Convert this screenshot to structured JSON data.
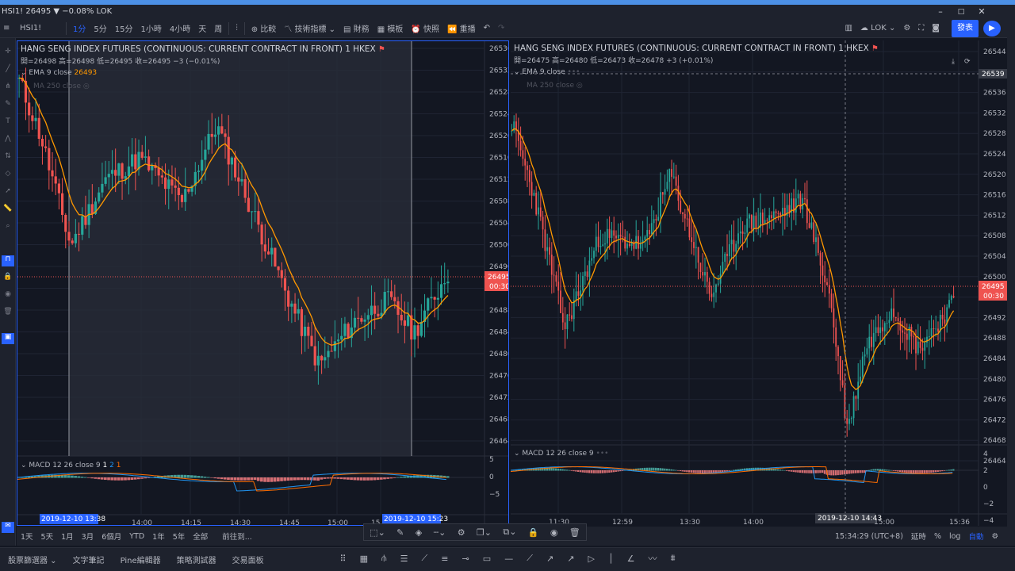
{
  "app": {
    "title": "HSI1! 26495 ▼ −0.08% LOK",
    "window_controls": [
      "–",
      "□",
      "✕",
      "–",
      "⧉"
    ]
  },
  "toolbar": {
    "symbol": "HSI1!",
    "intervals": [
      "1分",
      "5分",
      "15分",
      "1小時",
      "4小時",
      "天",
      "周"
    ],
    "active_interval": "1分",
    "buttons": [
      "比較",
      "技術指標",
      "財務",
      "模板",
      "快照",
      "重播"
    ],
    "layout_label": "LOK",
    "publish_label": "發表"
  },
  "bottom": {
    "ranges": [
      "1天",
      "5天",
      "1月",
      "3月",
      "6個月",
      "YTD",
      "1年",
      "5年",
      "全部"
    ],
    "goto": "前往到...",
    "clock": "15:34:29 (UTC+8)",
    "right": [
      "延時",
      "%",
      "log",
      "自動"
    ],
    "tabs": [
      "股票篩選器",
      "文字筆記",
      "Pine編輯器",
      "策略測試器",
      "交易面板"
    ]
  },
  "colors": {
    "up": "#26a69a",
    "down": "#ef5350",
    "ema": "#ff9800",
    "macd": "#2196f3",
    "signal": "#ff6d00",
    "accent": "#2962ff"
  },
  "pane1": {
    "title": "HANG SENG INDEX FUTURES (CONTINUOUS: CURRENT CONTRACT IN FRONT)",
    "interval": "1",
    "exchange": "HKEX",
    "ohlc": "開=26498  高=26498  低=26495  收=26495  −3 (−0.01%)",
    "ema_label": "EMA 9 close",
    "ema_value": "26493",
    "ma_label": "MA 250 close",
    "macd_label": "MACD 12 26 close 9",
    "macd_values": [
      "1",
      "2",
      "1"
    ],
    "price_ticks": [
      "26536",
      "26532",
      "26528",
      "26524",
      "26520",
      "26516",
      "26512",
      "26508",
      "26504",
      "26500",
      "26496",
      "26492",
      "26488",
      "26484",
      "26480",
      "26476",
      "26472",
      "26468",
      "26464"
    ],
    "macd_ticks": [
      "5",
      "0",
      "−5"
    ],
    "time_ticks": [
      "14:00",
      "14:15",
      "14:30",
      "14:45",
      "15:00",
      "15"
    ],
    "range_start": "2019-12-10  13:38",
    "range_end": "2019-12-10  15:23",
    "last_price": "26495",
    "countdown": "00:30"
  },
  "pane2": {
    "title": "HANG SENG INDEX FUTURES (CONTINUOUS: CURRENT CONTRACT IN FRONT)",
    "interval": "1",
    "exchange": "HKEX",
    "ohlc": "開=26475  高=26480  低=26473  收=26478  +3 (+0.01%)",
    "ema_label": "EMA 9 close",
    "ma_label": "MA 250 close",
    "macd_label": "MACD 12 26 close 9",
    "price_ticks": [
      "26544",
      "26540",
      "26536",
      "26532",
      "26528",
      "26524",
      "26520",
      "26516",
      "26512",
      "26508",
      "26504",
      "26500",
      "26496",
      "26492",
      "26488",
      "26484",
      "26480",
      "26476",
      "26472",
      "26468",
      "26464"
    ],
    "crosshair_price": "26539",
    "macd_ticks": [
      "4",
      "2",
      "0",
      "−2",
      "−4",
      "−6",
      "−8"
    ],
    "time_ticks": [
      "11:30",
      "12:59",
      "13:30",
      "14:00",
      "15:00",
      "15:36"
    ],
    "crosshair_time": "2019-12-10  14:43",
    "last_price": "26495",
    "countdown": "00:30"
  }
}
